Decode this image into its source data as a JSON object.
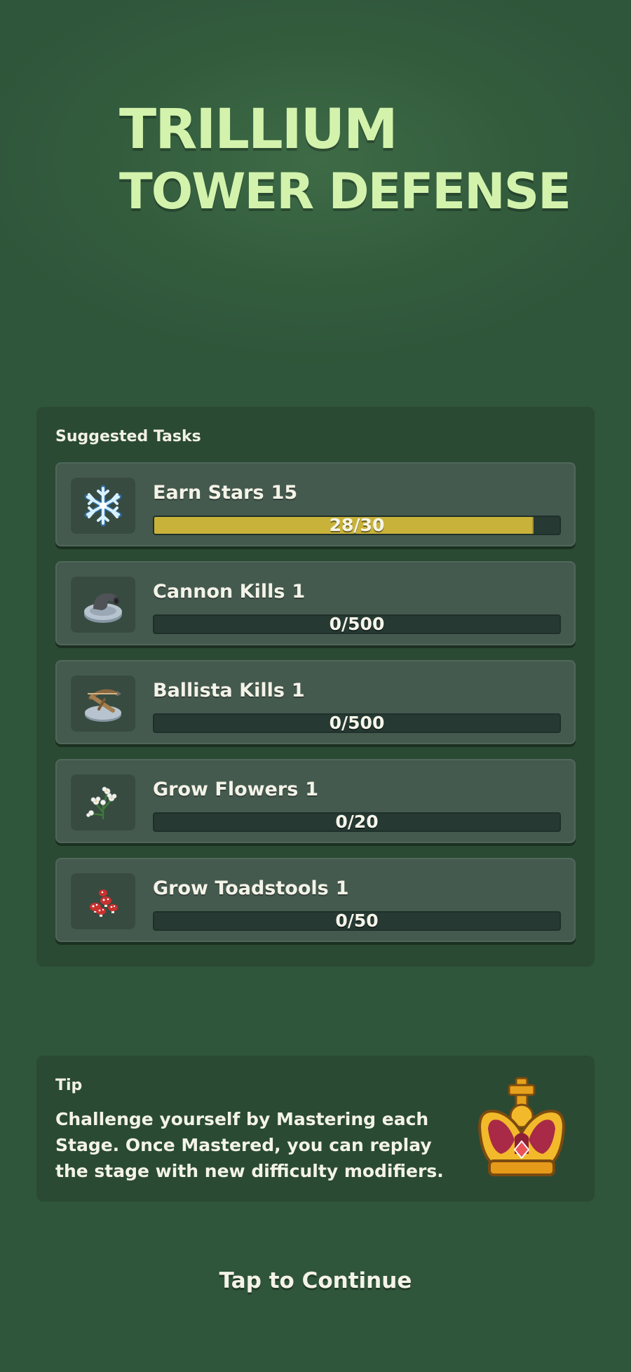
{
  "title": {
    "line1": "TRILLIUM",
    "line2": "TOWER DEFENSE"
  },
  "tasks_panel": {
    "heading": "Suggested Tasks",
    "tasks": [
      {
        "icon": "snowflake-icon",
        "label": "Earn Stars",
        "count": "15",
        "progress_text": "28/30",
        "progress": 0.933
      },
      {
        "icon": "cannon-icon",
        "label": "Cannon Kills",
        "count": "1",
        "progress_text": "0/500",
        "progress": 0
      },
      {
        "icon": "ballista-icon",
        "label": "Ballista Kills",
        "count": "1",
        "progress_text": "0/500",
        "progress": 0
      },
      {
        "icon": "flowers-icon",
        "label": "Grow Flowers",
        "count": "1",
        "progress_text": "0/20",
        "progress": 0
      },
      {
        "icon": "toadstools-icon",
        "label": "Grow Toadstools",
        "count": "1",
        "progress_text": "0/50",
        "progress": 0
      }
    ]
  },
  "tip": {
    "heading": "Tip",
    "text": "Challenge yourself by Mastering each Stage. Once Mastered, you can replay the stage with new difficulty modifiers.",
    "icon": "crown-icon"
  },
  "footer": {
    "continue_label": "Tap to Continue"
  },
  "colors": {
    "background": "#2f553a",
    "panel": "#2a4a33",
    "card": "#455a4f",
    "progress_fill": "#c8b23a",
    "title": "#d3f3ad"
  }
}
